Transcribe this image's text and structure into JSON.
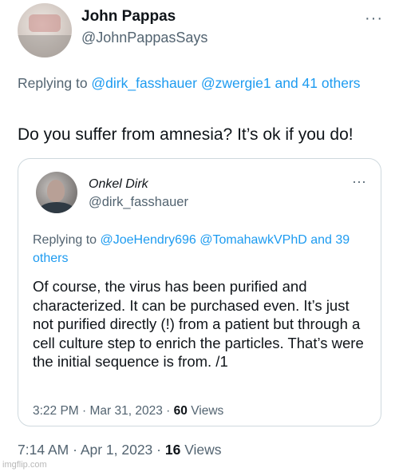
{
  "tweet": {
    "author_name": "John Pappas",
    "author_handle": "@JohnPappasSays",
    "more_glyph": "···",
    "replying_prefix": "Replying to ",
    "replying_mentions": "@dirk_fasshauer @zwergie1 and 41 others",
    "text": "Do you suffer from amnesia? It’s ok if you do!",
    "time": "7:14 AM",
    "separator": " · ",
    "date": "Apr 1, 2023",
    "views_count": "16",
    "views_label": " Views"
  },
  "quoted_tweet": {
    "author_name": "Onkel Dirk",
    "author_handle": "@dirk_fasshauer",
    "more_glyph": "···",
    "replying_prefix": "Replying to ",
    "replying_mentions": "@JoeHendry696 @TomahawkVPhD and 39 others",
    "text": "Of course, the virus has been purified and characterized. It can be purchased even. It’s just not purified directly (!) from a patient but through a cell culture step to enrich the particles. That’s were the initial sequence is from. /1",
    "time": "3:22 PM",
    "separator": " · ",
    "date": "Mar 31, 2023",
    "views_count": "60",
    "views_label": " Views"
  },
  "watermark": "imgflip.com",
  "colors": {
    "link": "#1d9bf0",
    "secondary_text": "#536471",
    "primary_text": "#0f1419",
    "border": "#cfd9de"
  }
}
